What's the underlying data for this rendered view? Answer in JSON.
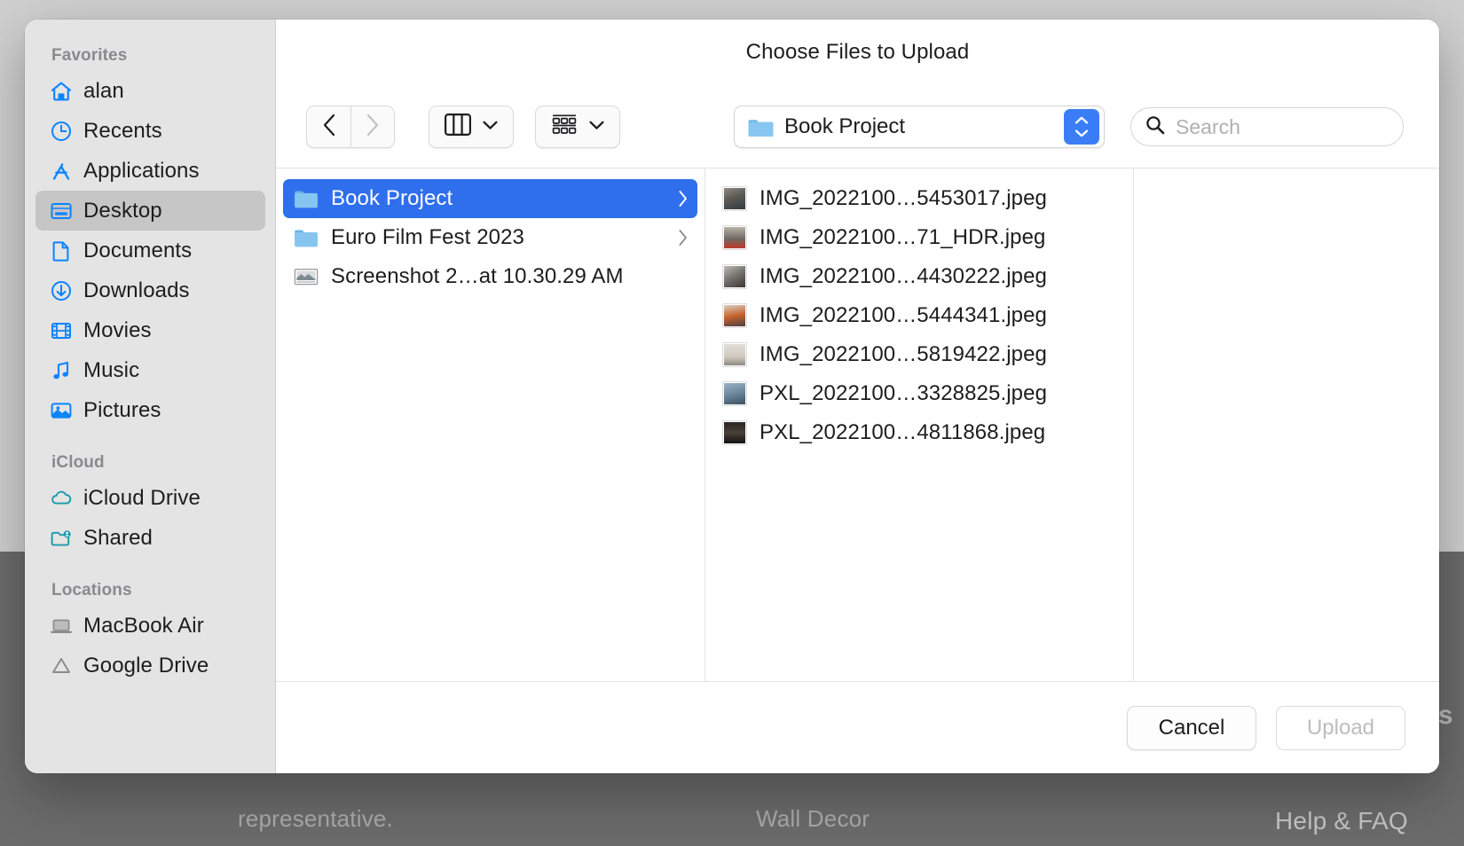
{
  "background": {
    "text_representative": "representative.",
    "text_wall_decor": "Wall Decor",
    "text_ks": "ks",
    "text_help_faq": "Help & FAQ"
  },
  "dialog": {
    "title": "Choose Files to Upload"
  },
  "sidebar": {
    "sections": [
      {
        "title": "Favorites",
        "items": [
          {
            "label": "alan",
            "icon": "home-icon",
            "selected": false
          },
          {
            "label": "Recents",
            "icon": "clock-icon",
            "selected": false
          },
          {
            "label": "Applications",
            "icon": "applications-icon",
            "selected": false
          },
          {
            "label": "Desktop",
            "icon": "desktop-icon",
            "selected": true
          },
          {
            "label": "Documents",
            "icon": "document-icon",
            "selected": false
          },
          {
            "label": "Downloads",
            "icon": "download-icon",
            "selected": false
          },
          {
            "label": "Movies",
            "icon": "film-icon",
            "selected": false
          },
          {
            "label": "Music",
            "icon": "music-note-icon",
            "selected": false
          },
          {
            "label": "Pictures",
            "icon": "picture-icon",
            "selected": false
          }
        ]
      },
      {
        "title": "iCloud",
        "items": [
          {
            "label": "iCloud Drive",
            "icon": "cloud-icon",
            "selected": false
          },
          {
            "label": "Shared",
            "icon": "shared-folder-icon",
            "selected": false
          }
        ]
      },
      {
        "title": "Locations",
        "items": [
          {
            "label": "MacBook Air",
            "icon": "laptop-icon",
            "selected": false
          },
          {
            "label": "Google Drive",
            "icon": "google-drive-icon",
            "selected": false
          }
        ]
      }
    ]
  },
  "toolbar": {
    "back_label": "Back",
    "forward_label": "Forward",
    "forward_disabled": true,
    "view_mode": "column-view",
    "arrange_mode": "group-items",
    "path": {
      "label": "Book Project",
      "icon": "folder-icon"
    },
    "search": {
      "value": "",
      "placeholder": "Search"
    }
  },
  "browser": {
    "columns": [
      {
        "name": "folders",
        "rows": [
          {
            "label": "Book Project",
            "icon": "folder-icon",
            "selected": true,
            "chevron": true
          },
          {
            "label": "Euro Film Fest 2023",
            "icon": "folder-icon",
            "selected": false,
            "chevron": true
          },
          {
            "label": "Screenshot 2…at 10.30.29 AM",
            "icon": "screenshot-icon",
            "selected": false,
            "chevron": false
          }
        ]
      },
      {
        "name": "files",
        "rows": [
          {
            "label": "IMG_2022100…5453017.jpeg",
            "icon": "photo-thumb-1",
            "selected": false,
            "chevron": false
          },
          {
            "label": "IMG_2022100…71_HDR.jpeg",
            "icon": "photo-thumb-2",
            "selected": false,
            "chevron": false
          },
          {
            "label": "IMG_2022100…4430222.jpeg",
            "icon": "photo-thumb-3",
            "selected": false,
            "chevron": false
          },
          {
            "label": "IMG_2022100…5444341.jpeg",
            "icon": "photo-thumb-4",
            "selected": false,
            "chevron": false
          },
          {
            "label": "IMG_2022100…5819422.jpeg",
            "icon": "photo-thumb-5",
            "selected": false,
            "chevron": false
          },
          {
            "label": "PXL_2022100…3328825.jpeg",
            "icon": "photo-thumb-6",
            "selected": false,
            "chevron": false
          },
          {
            "label": "PXL_2022100…4811868.jpeg",
            "icon": "photo-thumb-7",
            "selected": false,
            "chevron": false
          }
        ]
      },
      {
        "name": "preview",
        "rows": []
      }
    ]
  },
  "footer": {
    "cancel_label": "Cancel",
    "upload_label": "Upload",
    "upload_disabled": true
  },
  "colors": {
    "accent_blue": "#2f6fed",
    "sidebar_icon_blue": "#0a84ff",
    "icloud_teal": "#1a9aaa",
    "stepper_blue": "#3b7df6"
  }
}
